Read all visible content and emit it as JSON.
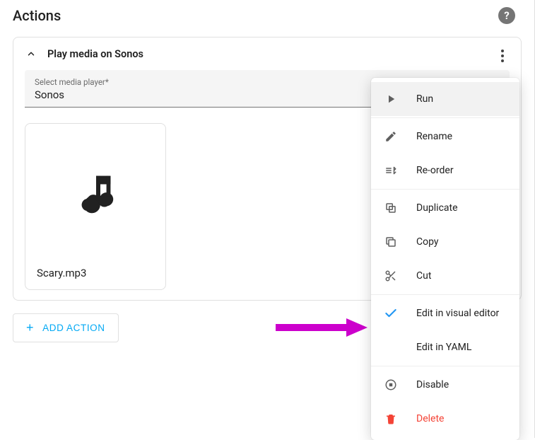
{
  "section_title": "Actions",
  "card": {
    "title": "Play media on Sonos",
    "field_label": "Select media player*",
    "field_value": "Sonos",
    "media_filename": "Scary.mp3"
  },
  "add_action_label": "ADD ACTION",
  "menu": {
    "run": "Run",
    "rename": "Rename",
    "reorder": "Re-order",
    "duplicate": "Duplicate",
    "copy": "Copy",
    "cut": "Cut",
    "edit_visual": "Edit in visual editor",
    "edit_yaml": "Edit in YAML",
    "disable": "Disable",
    "delete": "Delete"
  }
}
